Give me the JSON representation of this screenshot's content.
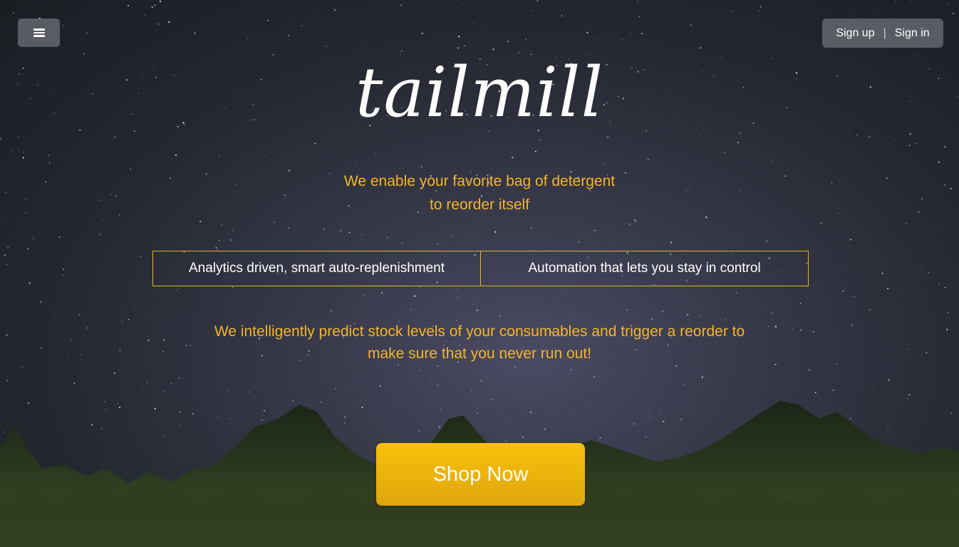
{
  "header": {
    "menu_icon": "hamburger-menu-icon",
    "sign_up_label": "Sign up",
    "separator": "|",
    "sign_in_label": "Sign in"
  },
  "hero": {
    "logo_text": "tailmill",
    "tagline_line1": "We enable your favorite bag of detergent",
    "tagline_line2": "to reorder itself",
    "features": [
      "Analytics driven, smart auto-replenishment",
      "Automation that lets you stay in control"
    ],
    "description_line1": "We intelligently predict stock levels of your consumables and trigger a reorder to",
    "description_line2": "make sure that you never run out!",
    "cta_label": "Shop Now"
  },
  "colors": {
    "accent": "#f4b52a",
    "button": "#f3b80a",
    "text": "#ffffff"
  }
}
